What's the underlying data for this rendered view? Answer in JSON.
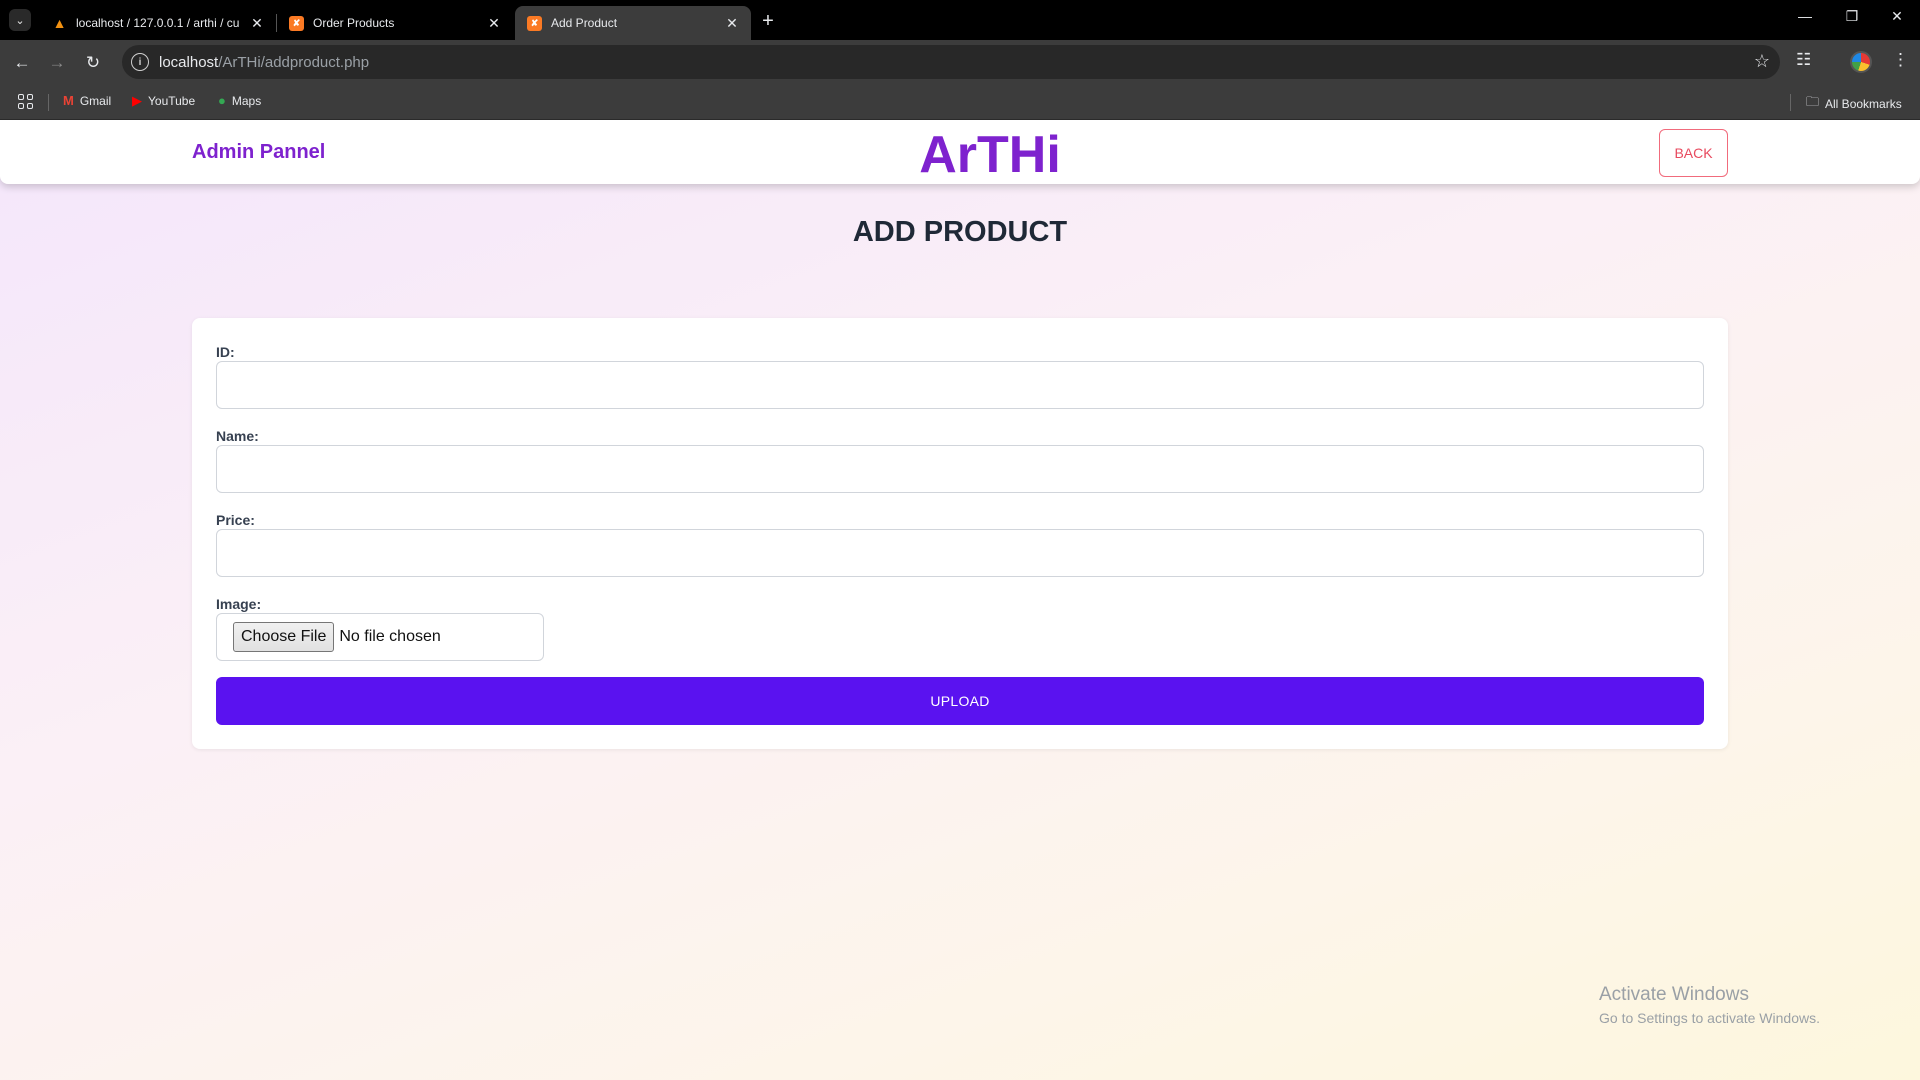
{
  "browser": {
    "tabs": [
      {
        "title": "localhost / 127.0.0.1 / arthi / cu",
        "favicon": "phpmyadmin-icon",
        "active": false
      },
      {
        "title": "Order Products",
        "favicon": "xampp-icon",
        "active": false
      },
      {
        "title": "Add Product",
        "favicon": "xampp-icon",
        "active": true
      }
    ],
    "url_host": "localhost",
    "url_path": "/ArTHi/addproduct.php",
    "bookmarks": [
      {
        "label": "Gmail",
        "icon": "gmail-icon"
      },
      {
        "label": "YouTube",
        "icon": "youtube-icon"
      },
      {
        "label": "Maps",
        "icon": "maps-icon"
      }
    ],
    "all_bookmarks": "All Bookmarks"
  },
  "header": {
    "admin_title": "Admin Pannel",
    "brand": "ArTHi",
    "back_label": "BACK"
  },
  "main": {
    "heading": "ADD PRODUCT",
    "form": {
      "id_label": "ID:",
      "id_value": "",
      "name_label": "Name:",
      "name_value": "",
      "price_label": "Price:",
      "price_value": "",
      "image_label": "Image:",
      "choose_file_label": "Choose File",
      "no_file_text": "No file chosen",
      "upload_label": "UPLOAD"
    }
  },
  "watermark": {
    "title": "Activate Windows",
    "subtitle": "Go to Settings to activate Windows."
  },
  "colors": {
    "brand_purple": "#7e22ce",
    "upload_button": "#5a12f0",
    "back_button_red": "#e84a5f"
  }
}
